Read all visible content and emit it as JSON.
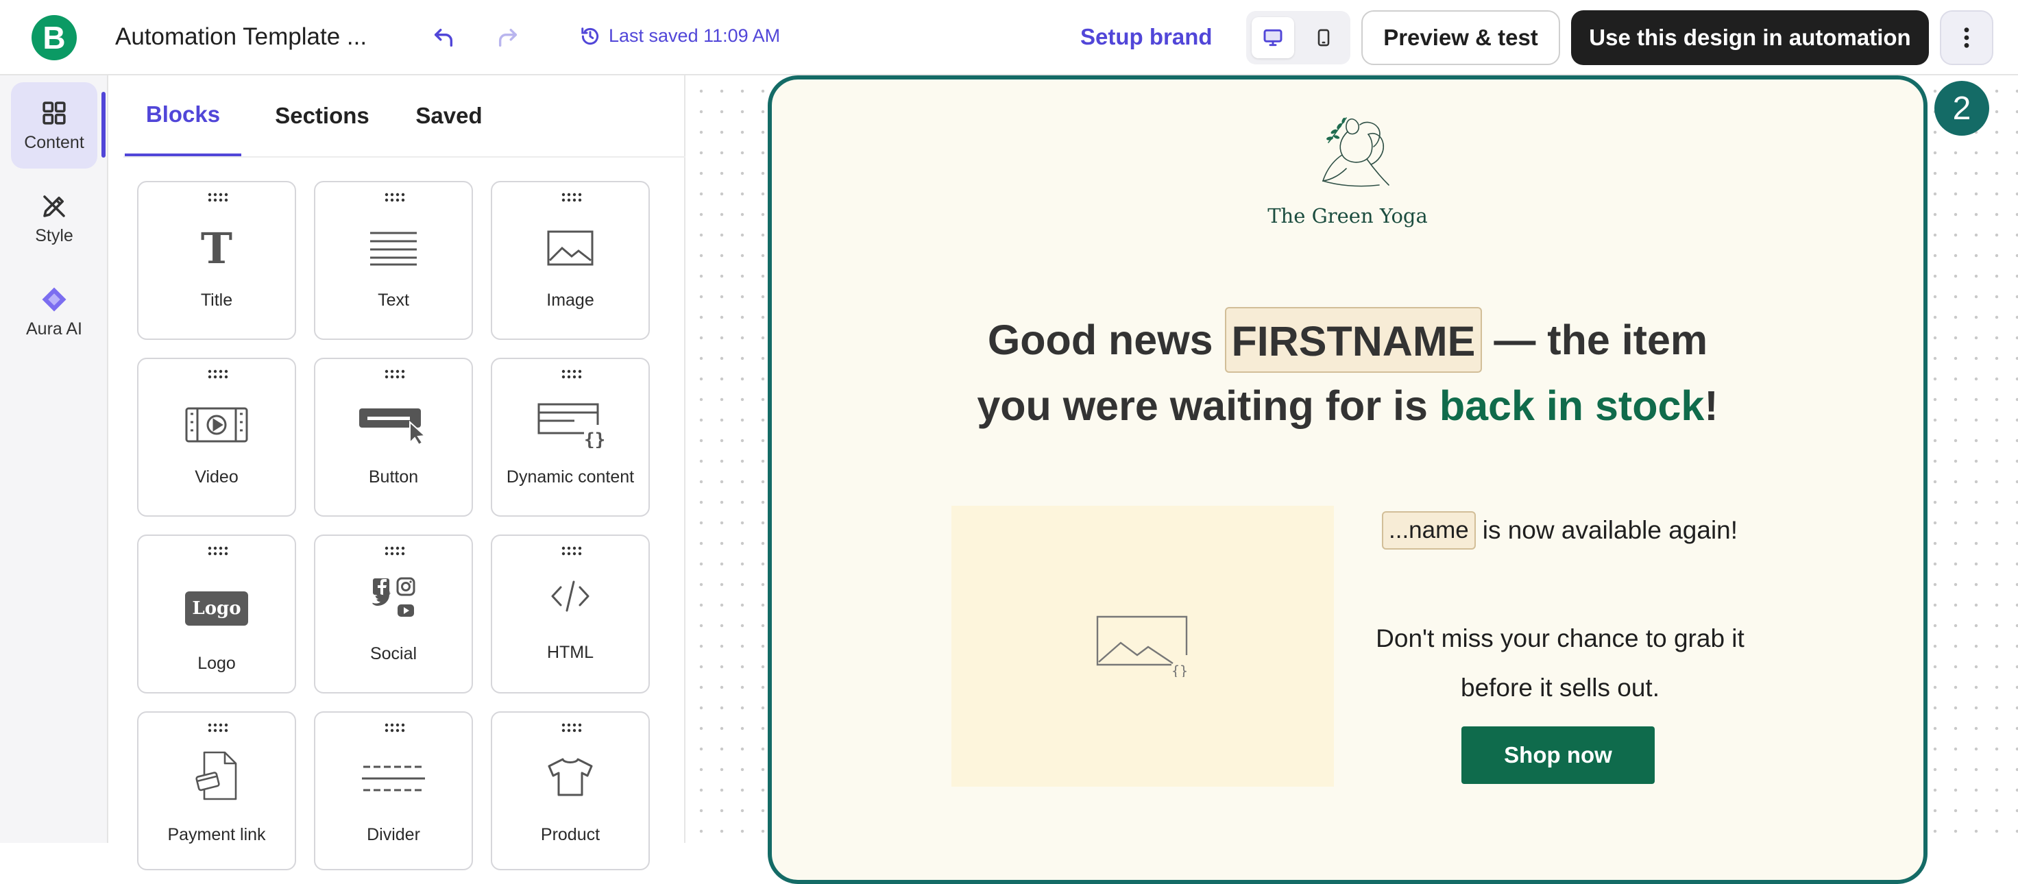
{
  "header": {
    "logo_letter": "B",
    "title": "Automation Template ...",
    "last_saved": "Last saved 11:09 AM",
    "setup_brand": "Setup brand",
    "preview_label": "Preview & test",
    "use_design_label": "Use this design in automation",
    "brand_color": "#0b9a64",
    "accent_color": "#5146d8",
    "active_device": "desktop"
  },
  "rail": {
    "items": [
      {
        "label": "Content",
        "icon": "grid-icon",
        "active": true
      },
      {
        "label": "Style",
        "icon": "brush-icon",
        "active": false
      },
      {
        "label": "Aura AI",
        "icon": "sparkle-diamond-icon",
        "active": false
      }
    ]
  },
  "panel": {
    "tabs": [
      {
        "label": "Blocks",
        "active": true
      },
      {
        "label": "Sections",
        "active": false
      },
      {
        "label": "Saved",
        "active": false
      }
    ],
    "blocks": [
      {
        "label": "Title",
        "icon": "title-T-icon"
      },
      {
        "label": "Text",
        "icon": "text-lines-icon"
      },
      {
        "label": "Image",
        "icon": "image-icon"
      },
      {
        "label": "Video",
        "icon": "video-icon"
      },
      {
        "label": "Button",
        "icon": "button-cursor-icon"
      },
      {
        "label": "Dynamic content",
        "icon": "dynamic-content-icon"
      },
      {
        "label": "Logo",
        "icon": "logo-badge-icon",
        "icon_text": "Logo"
      },
      {
        "label": "Social",
        "icon": "social-icons-icon"
      },
      {
        "label": "HTML",
        "icon": "code-icon"
      },
      {
        "label": "Payment link",
        "icon": "payment-doc-icon"
      },
      {
        "label": "Divider",
        "icon": "divider-icon"
      },
      {
        "label": "Product",
        "icon": "tshirt-icon"
      }
    ]
  },
  "email": {
    "step_number": "2",
    "brand_name": "The Green Yoga",
    "headline_part1": "Good news",
    "headline_tag": "FIRSTNAME",
    "headline_part2": "— the item",
    "headline_part3": "you were waiting for is",
    "headline_accent": "back in stock",
    "headline_end": "!",
    "name_tag": "...name",
    "available_text": "is now available again!",
    "body_line1": "Don't miss your chance to grab it",
    "body_line2": "before it sells out.",
    "shop_button": "Shop now",
    "frame_color": "#146b66",
    "button_color": "#0f6b4c"
  }
}
